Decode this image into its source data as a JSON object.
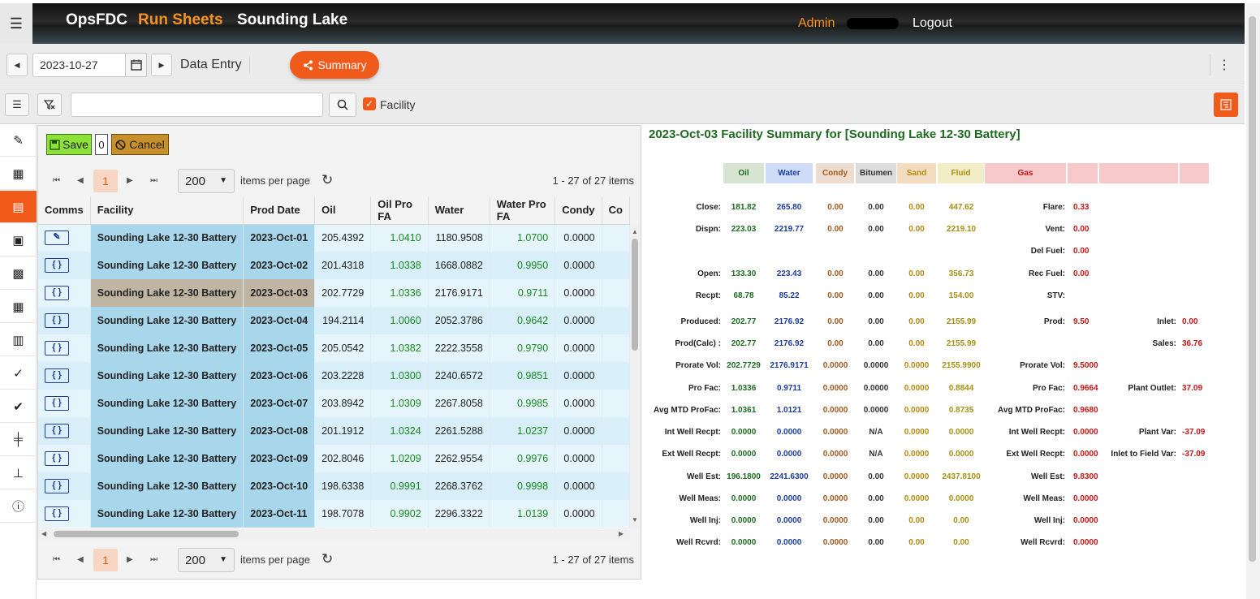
{
  "header": {
    "app_name": "OpsFDC",
    "module": "Run Sheets",
    "site": "Sounding Lake",
    "admin": "Admin",
    "logout": "Logout"
  },
  "toolbar": {
    "date": "2023-10-27",
    "section": "Data Entry",
    "summary_label": "Summary"
  },
  "filter": {
    "facility_label": "Facility",
    "facility_checked": true,
    "search_value": ""
  },
  "actions": {
    "save_label": "Save",
    "pending_count": "0",
    "cancel_label": "Cancel"
  },
  "pager": {
    "current_page": "1",
    "page_size": "200",
    "items_per_page_label": "items per page",
    "info": "1 - 27 of 27 items"
  },
  "grid": {
    "columns": [
      "Comms",
      "Facility",
      "Prod Date",
      "Oil",
      "Oil Pro FA",
      "Water",
      "Water Pro FA",
      "Condy",
      "Co"
    ],
    "rows": [
      {
        "facility": "Sounding Lake 12-30 Battery",
        "date": "2023-Oct-01",
        "oil": "205.4392",
        "oil_fa": "1.0410",
        "water": "1180.9508",
        "water_fa": "1.0700",
        "condy": "0.0000"
      },
      {
        "facility": "Sounding Lake 12-30 Battery",
        "date": "2023-Oct-02",
        "oil": "201.4318",
        "oil_fa": "1.0338",
        "water": "1668.0882",
        "water_fa": "0.9950",
        "condy": "0.0000"
      },
      {
        "facility": "Sounding Lake 12-30 Battery",
        "date": "2023-Oct-03",
        "oil": "202.7729",
        "oil_fa": "1.0336",
        "water": "2176.9171",
        "water_fa": "0.9711",
        "condy": "0.0000"
      },
      {
        "facility": "Sounding Lake 12-30 Battery",
        "date": "2023-Oct-04",
        "oil": "194.2114",
        "oil_fa": "1.0060",
        "water": "2052.3786",
        "water_fa": "0.9642",
        "condy": "0.0000"
      },
      {
        "facility": "Sounding Lake 12-30 Battery",
        "date": "2023-Oct-05",
        "oil": "205.0542",
        "oil_fa": "1.0382",
        "water": "2222.3558",
        "water_fa": "0.9790",
        "condy": "0.0000"
      },
      {
        "facility": "Sounding Lake 12-30 Battery",
        "date": "2023-Oct-06",
        "oil": "203.2228",
        "oil_fa": "1.0300",
        "water": "2240.6572",
        "water_fa": "0.9851",
        "condy": "0.0000"
      },
      {
        "facility": "Sounding Lake 12-30 Battery",
        "date": "2023-Oct-07",
        "oil": "203.8942",
        "oil_fa": "1.0309",
        "water": "2267.8058",
        "water_fa": "0.9985",
        "condy": "0.0000"
      },
      {
        "facility": "Sounding Lake 12-30 Battery",
        "date": "2023-Oct-08",
        "oil": "201.1912",
        "oil_fa": "1.0324",
        "water": "2261.5288",
        "water_fa": "1.0237",
        "condy": "0.0000"
      },
      {
        "facility": "Sounding Lake 12-30 Battery",
        "date": "2023-Oct-09",
        "oil": "202.8046",
        "oil_fa": "1.0209",
        "water": "2262.9554",
        "water_fa": "0.9976",
        "condy": "0.0000"
      },
      {
        "facility": "Sounding Lake 12-30 Battery",
        "date": "2023-Oct-10",
        "oil": "198.6338",
        "oil_fa": "0.9991",
        "water": "2268.3762",
        "water_fa": "0.9998",
        "condy": "0.0000"
      },
      {
        "facility": "Sounding Lake 12-30 Battery",
        "date": "2023-Oct-11",
        "oil": "198.7078",
        "oil_fa": "0.9902",
        "water": "2296.3322",
        "water_fa": "1.0139",
        "condy": "0.0000"
      }
    ],
    "selected_row": 2
  },
  "summary": {
    "title": "2023-Oct-03 Facility Summary for [Sounding Lake 12-30 Battery]",
    "headers": [
      "Oil",
      "Water",
      "Condy",
      "Bitumen",
      "Sand",
      "Fluid",
      "Gas"
    ],
    "liquid_rows": [
      {
        "label": "Close:",
        "v": [
          "181.82",
          "265.80",
          "0.00",
          "0.00",
          "0.00",
          "447.62"
        ]
      },
      {
        "label": "Dispn:",
        "v": [
          "223.03",
          "2219.77",
          "0.00",
          "0.00",
          "0.00",
          "2219.10"
        ]
      },
      {
        "label": "Open:",
        "v": [
          "133.30",
          "223.43",
          "0.00",
          "0.00",
          "0.00",
          "356.73"
        ]
      },
      {
        "label": "Recpt:",
        "v": [
          "68.78",
          "85.22",
          "0.00",
          "0.00",
          "0.00",
          "154.00"
        ]
      },
      {
        "label": "Produced:",
        "v": [
          "202.77",
          "2176.92",
          "0.00",
          "0.00",
          "0.00",
          "2155.99"
        ]
      },
      {
        "label": "Prod(Calc) :",
        "v": [
          "202.77",
          "2176.92",
          "0.00",
          "0.00",
          "0.00",
          "2155.99"
        ]
      },
      {
        "label": "Prorate Vol:",
        "v": [
          "202.7729",
          "2176.9171",
          "0.0000",
          "0.0000",
          "0.0000",
          "2155.9900"
        ]
      },
      {
        "label": "Pro Fac:",
        "v": [
          "1.0336",
          "0.9711",
          "0.0000",
          "0.0000",
          "0.0000",
          "0.8844"
        ]
      },
      {
        "label": "Avg MTD ProFac:",
        "v": [
          "1.0361",
          "1.0121",
          "0.0000",
          "0.0000",
          "0.0000",
          "0.8735"
        ]
      },
      {
        "label": "Int Well Recpt:",
        "v": [
          "0.0000",
          "0.0000",
          "0.0000",
          "N/A",
          "0.0000",
          "0.0000"
        ]
      },
      {
        "label": "Ext Well Recpt:",
        "v": [
          "0.0000",
          "0.0000",
          "0.0000",
          "N/A",
          "0.0000",
          "0.0000"
        ]
      },
      {
        "label": "Well Est:",
        "v": [
          "196.1800",
          "2241.6300",
          "0.0000",
          "0.00",
          "0.0000",
          "2437.8100"
        ]
      },
      {
        "label": "Well Meas:",
        "v": [
          "0.0000",
          "0.0000",
          "0.0000",
          "0.00",
          "0.0000",
          "0.0000"
        ]
      },
      {
        "label": "Well Inj:",
        "v": [
          "0.0000",
          "0.0000",
          "0.0000",
          "0.00",
          "0.00",
          "0.00"
        ]
      },
      {
        "label": "Well Rcvrd:",
        "v": [
          "0.0000",
          "0.0000",
          "0.0000",
          "0.00",
          "0.00",
          "0.00"
        ]
      }
    ],
    "gas_rows": [
      {
        "label": "Flare:",
        "value": "0.33"
      },
      {
        "label": "Vent:",
        "value": "0.00"
      },
      {
        "label": "Del Fuel:",
        "value": "0.00"
      },
      {
        "label": "Rec Fuel:",
        "value": "0.00"
      },
      {
        "label": "STV:",
        "value": ""
      },
      {
        "label": "Prod:",
        "value": "9.50"
      },
      {
        "label": "Prorate Vol:",
        "value": "9.5000"
      },
      {
        "label": "Pro Fac:",
        "value": "0.9664"
      },
      {
        "label": "Avg MTD ProFac:",
        "value": "0.9680"
      },
      {
        "label": "Int Well Recpt:",
        "value": "0.0000"
      },
      {
        "label": "Ext Well Recpt:",
        "value": "0.0000"
      },
      {
        "label": "Well Est:",
        "value": "9.8300"
      },
      {
        "label": "Well Meas:",
        "value": "0.0000"
      },
      {
        "label": "Well Inj:",
        "value": "0.0000"
      },
      {
        "label": "Well Rcvrd:",
        "value": "0.0000"
      }
    ],
    "plant_rows": [
      {
        "label": "Inlet:",
        "value": "0.00"
      },
      {
        "label": "Sales:",
        "value": "36.76"
      },
      {
        "label": "Plant Outlet:",
        "value": "37.09"
      },
      {
        "label": "Plant Var:",
        "value": "-37.09"
      },
      {
        "label": "Inlet to Field Var:",
        "value": "-37.09"
      }
    ]
  },
  "colors": {
    "accent": "#f05a1a",
    "brand_orange": "#f7931e",
    "oil": "#1d6b20",
    "water": "#1c3c9c",
    "gas": "#c41616"
  },
  "icons": [
    "hamburger-icon",
    "calendar-icon",
    "share-icon",
    "kebab-icon",
    "list-icon",
    "filter-icon",
    "search-icon",
    "check-icon",
    "panel-icon",
    "pencil-icon",
    "grid-icon",
    "table-icon",
    "monitor-icon",
    "report-icon",
    "checkmark-icon",
    "check-circle-icon",
    "well-icon",
    "tank-icon",
    "info-icon",
    "floppy-icon",
    "cancel-icon",
    "refresh-icon"
  ]
}
